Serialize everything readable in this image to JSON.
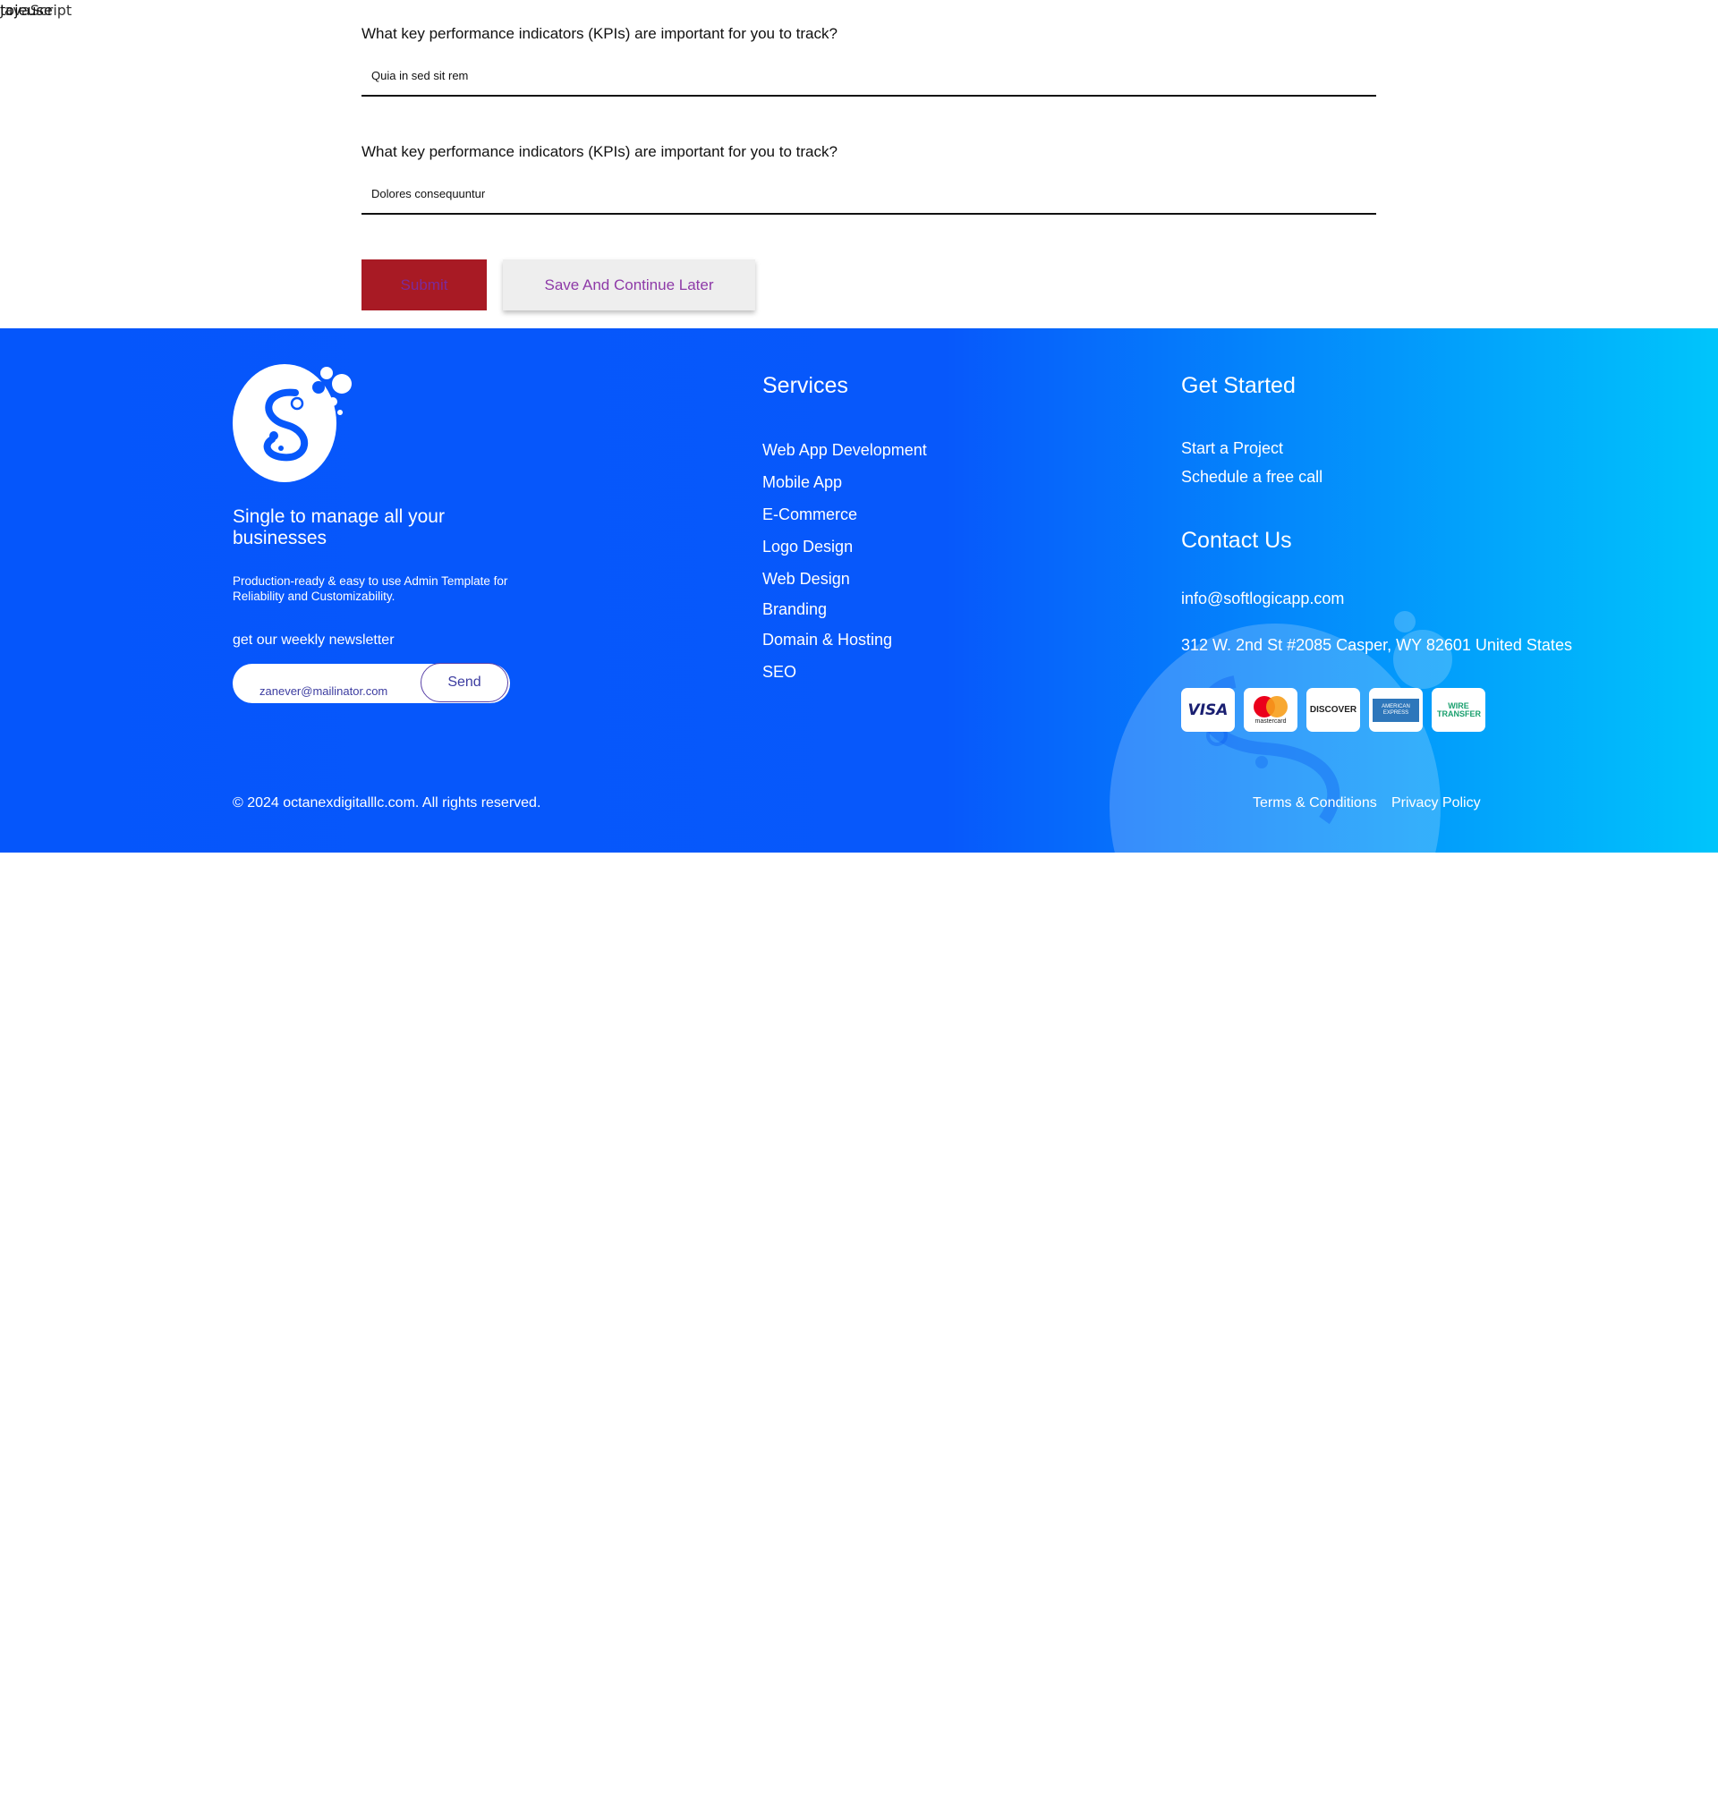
{
  "corner": {
    "back_text": "JavaScript",
    "front_text": "tojeuse"
  },
  "form": {
    "questions": [
      {
        "label": "What key performance indicators (KPIs) are important for you to track?",
        "value": "Quia in sed sit rem"
      },
      {
        "label": "What key performance indicators (KPIs) are important for you to track?",
        "value": "Dolores consequuntur"
      }
    ],
    "submit_label": "Submit",
    "save_label": "Save And Continue Later"
  },
  "footer": {
    "tagline": "Single to manage all your businesses",
    "description": "Production-ready & easy to use Admin Template for Reliability and Customizability.",
    "newsletter_label": "get our weekly newsletter",
    "newsletter_value": "zanever@mailinator.com",
    "send_label": "Send",
    "services_title": "Services",
    "services": [
      "Web App Development",
      "Mobile App",
      "E-Commerce",
      "Logo Design",
      "Web Design",
      "Branding",
      "Domain & Hosting",
      "SEO"
    ],
    "get_started_title": "Get Started",
    "get_started_links": [
      "Start a Project",
      "Schedule a free call"
    ],
    "contact_title": "Contact Us",
    "email": "info@softlogicapp.com",
    "address": "312 W. 2nd St #2085 Casper, WY 82601 United States",
    "payment_cards": [
      {
        "name": "VISA",
        "icon": "visa-card-icon",
        "color": "#1a1f71"
      },
      {
        "name": "mastercard",
        "icon": "mastercard-card-icon",
        "color": "#eb001b"
      },
      {
        "name": "DISCOVER",
        "icon": "discover-card-icon",
        "color": "#f58220"
      },
      {
        "name": "AMERICAN EXPRESS",
        "icon": "amex-card-icon",
        "color": "#2e77bb"
      },
      {
        "name": "WIRE TRANSFER",
        "icon": "wire-transfer-card-icon",
        "color": "#1aa06e"
      }
    ],
    "copyright": "© 2024 octanexdigitalllc.com. All rights reserved.",
    "terms_label": "Terms & Conditions",
    "privacy_label": "Privacy Policy"
  },
  "colors": {
    "footer_start": "#0556fb",
    "footer_end": "#00c5fb",
    "submit_bg": "#a81a24",
    "accent_purple": "#8e3aa8"
  }
}
